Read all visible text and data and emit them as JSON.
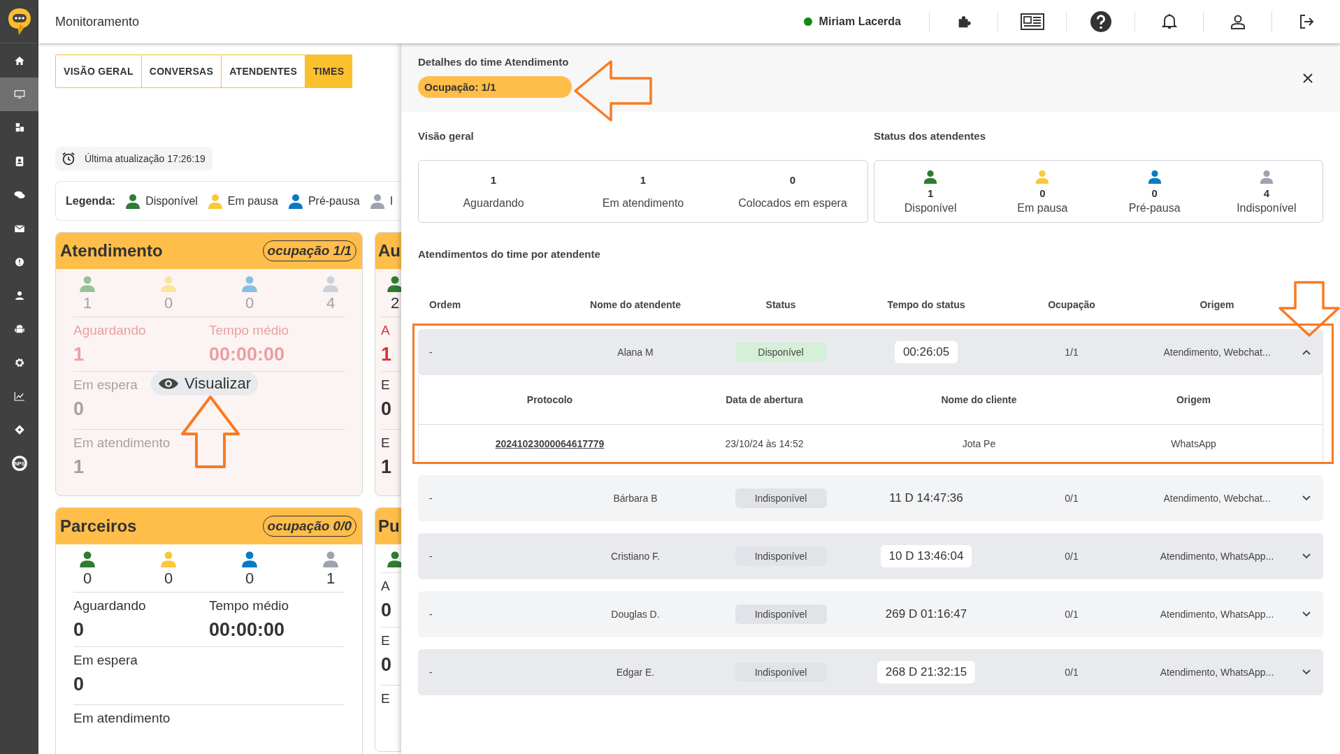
{
  "app": {
    "title": "Monitoramento",
    "user": {
      "name": "Miriam Lacerda",
      "online": true
    }
  },
  "sidebar": {
    "items": [
      {
        "kind": "home",
        "selected": false
      },
      {
        "kind": "monitor",
        "selected": true
      },
      {
        "kind": "cubes",
        "selected": false
      },
      {
        "kind": "contact",
        "selected": false
      },
      {
        "kind": "chat",
        "selected": false
      },
      {
        "kind": "mail",
        "selected": false
      },
      {
        "kind": "bug",
        "selected": false
      },
      {
        "kind": "person",
        "selected": false
      },
      {
        "kind": "android",
        "selected": false
      },
      {
        "kind": "gear",
        "selected": false
      },
      {
        "kind": "chart",
        "selected": false
      },
      {
        "kind": "ticket",
        "selected": false
      },
      {
        "kind": "nps",
        "selected": false,
        "label": "NPS"
      }
    ]
  },
  "tabs": [
    {
      "label": "VISÃO GERAL",
      "selected": false
    },
    {
      "label": "CONVERSAS",
      "selected": false
    },
    {
      "label": "ATENDENTES",
      "selected": false
    },
    {
      "label": "TIMES",
      "selected": true
    }
  ],
  "last_update": "Última atualização 17:26:19",
  "legend": {
    "title": "Legenda:",
    "items": [
      {
        "color": "#2e7d32",
        "label": "Disponível"
      },
      {
        "color": "#f9c93a",
        "label": "Em pausa"
      },
      {
        "color": "#0a7ac4",
        "label": "Pré-pausa"
      },
      {
        "color": "#9ea3b0",
        "label": "I"
      }
    ]
  },
  "cards": [
    {
      "title": "Atendimento",
      "occupancy": "ocupação 1/1",
      "hovered": true,
      "action": "Visualizar",
      "counts": [
        {
          "color": "#97c299",
          "value": "1"
        },
        {
          "color": "#fbe49c",
          "value": "0"
        },
        {
          "color": "#85bfe4",
          "value": "0"
        },
        {
          "color": "#cdd0d7",
          "value": "4"
        }
      ],
      "metrics": [
        {
          "label": "Aguardando",
          "value": "1",
          "alert": true
        },
        {
          "label": "Tempo médio",
          "value": "00:00:00",
          "alert": true
        }
      ],
      "rows": [
        {
          "label": "Em espera",
          "value": "0"
        },
        {
          "label": "Em atendimento",
          "value": "1"
        }
      ]
    },
    {
      "title": "Au",
      "hovered": false,
      "counts": [
        {
          "color": "#2e7d32",
          "value": "2"
        }
      ],
      "metrics": [
        {
          "label": "A",
          "value": "1",
          "alert": true
        }
      ],
      "rows": [
        {
          "label": "E",
          "value": "0"
        },
        {
          "label": "E",
          "value": "1"
        }
      ]
    },
    {
      "title": "Parceiros",
      "occupancy": "ocupação 0/0",
      "hovered": false,
      "counts": [
        {
          "color": "#2e7d32",
          "value": "0"
        },
        {
          "color": "#f9c93a",
          "value": "0"
        },
        {
          "color": "#0a7ac4",
          "value": "0"
        },
        {
          "color": "#9ea3b0",
          "value": "1"
        }
      ],
      "metrics": [
        {
          "label": "Aguardando",
          "value": "0",
          "alert": false
        },
        {
          "label": "Tempo médio",
          "value": "00:00:00",
          "alert": false
        }
      ],
      "rows": [
        {
          "label": "Em espera",
          "value": "0"
        },
        {
          "label": "Em atendimento"
        }
      ]
    },
    {
      "title": "Pu",
      "hovered": false,
      "counts": [
        {
          "color": "#2e7d32"
        }
      ],
      "metrics": [
        {
          "label": "A",
          "value": "0",
          "alert": false
        }
      ],
      "rows": [
        {
          "label": "E",
          "value": "0"
        },
        {
          "label": "E"
        }
      ]
    }
  ],
  "drawer": {
    "title": "Detalhes do time Atendimento",
    "occupancy": "Ocupação: 1/1",
    "overview": {
      "title": "Visão geral",
      "items": [
        {
          "value": "1",
          "label": "Aguardando"
        },
        {
          "value": "1",
          "label": "Em atendimento"
        },
        {
          "value": "0",
          "label": "Colocados em espera"
        }
      ]
    },
    "statuses": {
      "title": "Status dos atendentes",
      "items": [
        {
          "color": "#2e7d32",
          "value": "1",
          "label": "Disponível"
        },
        {
          "color": "#f9c93a",
          "value": "0",
          "label": "Em pausa"
        },
        {
          "color": "#0a7ac4",
          "value": "0",
          "label": "Pré-pausa"
        },
        {
          "color": "#9ea3b0",
          "value": "4",
          "label": "Indisponível"
        }
      ]
    },
    "table": {
      "title": "Atendimentos do time por atendente",
      "columns": [
        "Ordem",
        "Nome do atendente",
        "Status",
        "Tempo do status",
        "Ocupação",
        "Origem"
      ],
      "rows": [
        {
          "order": "-",
          "name": "Alana M",
          "status": "Disponível",
          "color": "#d6efd8",
          "time": "00:26:05",
          "occupancy": "1/1",
          "origin": "Atendimento, Webchat...",
          "expanded": true,
          "detail": {
            "columns": [
              "Protocolo",
              "Data de abertura",
              "Nome do cliente",
              "Origem"
            ],
            "rows": [
              {
                "protocol": "20241023000064617779",
                "opened": "23/10/24 às 14:52",
                "client": "Jota Pe",
                "origin": "WhatsApp"
              }
            ]
          }
        },
        {
          "order": "-",
          "name": "Bárbara B",
          "status": "Indisponível",
          "color": "#e1e3e8",
          "time": "11 D 14:47:36",
          "occupancy": "0/1",
          "origin": "Atendimento, Webchat...",
          "expanded": false
        },
        {
          "order": "-",
          "name": "Cristiano F.",
          "status": "Indisponível",
          "color": "#e1e3e8",
          "time": "10 D 13:46:04",
          "occupancy": "0/1",
          "origin": "Atendimento, WhatsApp...",
          "expanded": false
        },
        {
          "order": "-",
          "name": "Douglas D.",
          "status": "Indisponível",
          "color": "#e1e3e8",
          "time": "269 D 01:16:47",
          "occupancy": "0/1",
          "origin": "Atendimento, WhatsApp...",
          "expanded": false
        },
        {
          "order": "-",
          "name": "Edgar E.",
          "status": "Indisponível",
          "color": "#e1e3e8",
          "time": "268 D 21:32:15",
          "occupancy": "0/1",
          "origin": "Atendimento, WhatsApp...",
          "expanded": false
        }
      ]
    }
  }
}
